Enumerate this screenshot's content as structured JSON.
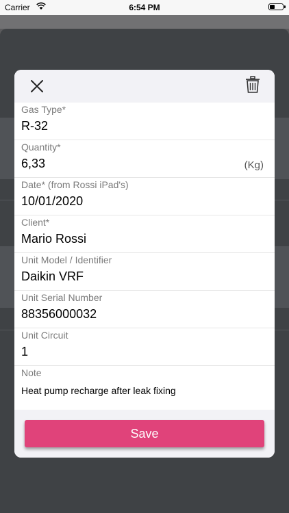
{
  "status_bar": {
    "carrier": "Carrier",
    "time": "6:54 PM",
    "icons": [
      "wifi-icon",
      "battery-icon"
    ]
  },
  "header": {
    "close_icon": "close-icon",
    "delete_icon": "trash-icon"
  },
  "fields": [
    {
      "label": "Gas Type*",
      "value": "R-32"
    },
    {
      "label": "Quantity*",
      "value": "6,33",
      "unit": "(Kg)"
    },
    {
      "label": "Date*  (from Rossi iPad's)",
      "value": "10/01/2020"
    },
    {
      "label": "Client*",
      "value": "Mario Rossi"
    },
    {
      "label": "Unit Model / Identifier",
      "value": "Daikin VRF"
    },
    {
      "label": "Unit Serial Number",
      "value": "88356000032"
    },
    {
      "label": "Unit Circuit",
      "value": "1"
    }
  ],
  "note": {
    "label": "Note",
    "value": "Heat pump recharge after leak fixing"
  },
  "save_button": {
    "label": "Save"
  },
  "colors": {
    "accent": "#e0437a",
    "overlay": "#3f4245",
    "header_bg": "#f2f2f6"
  }
}
